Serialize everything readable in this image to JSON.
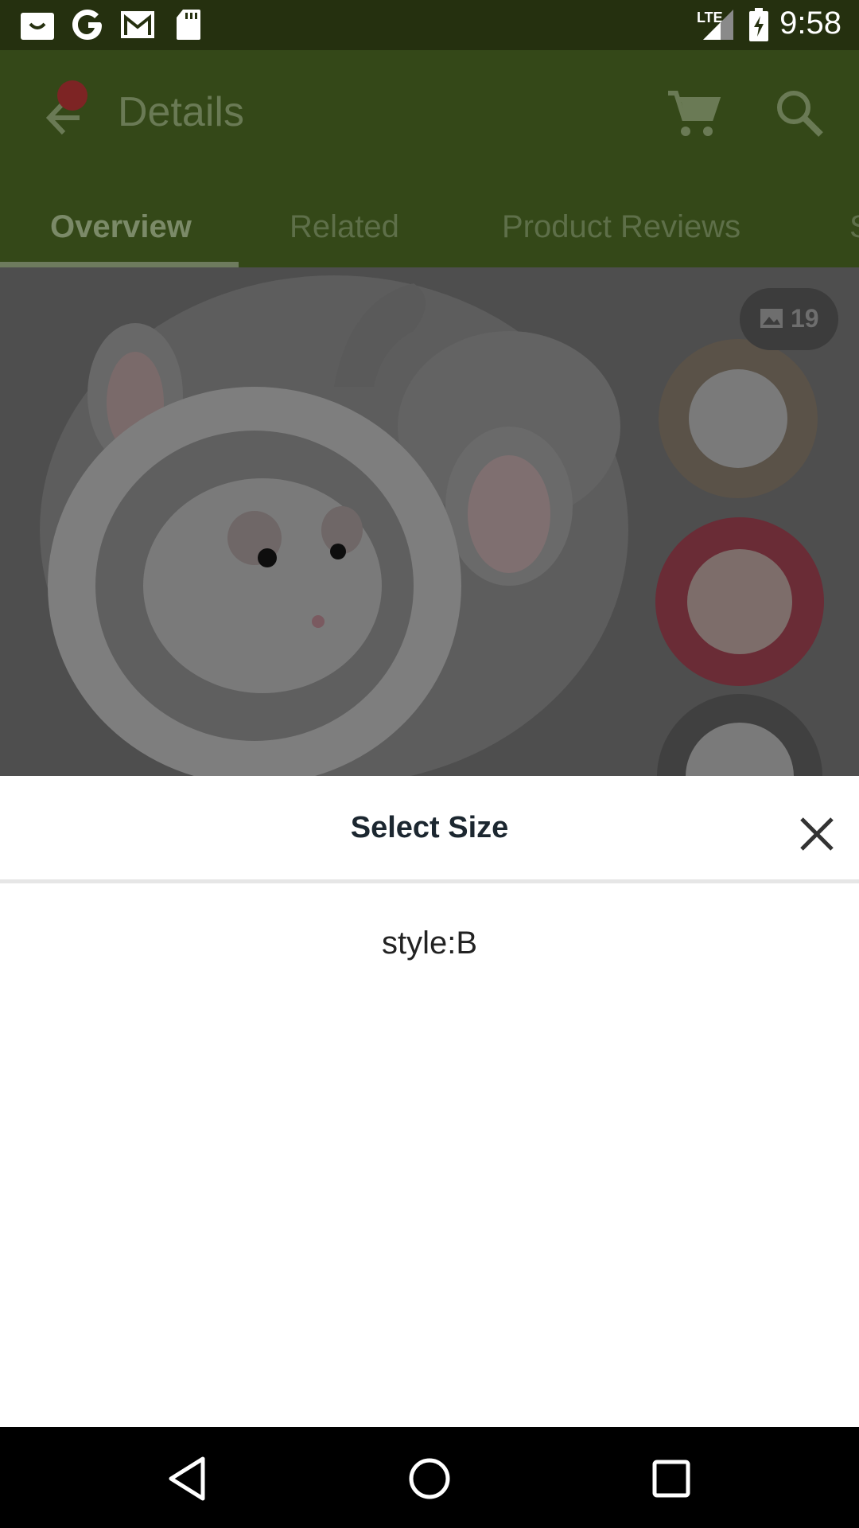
{
  "status_bar": {
    "time": "9:58",
    "network": "LTE",
    "icons": [
      "shopping-bag-icon",
      "google-icon",
      "gmail-icon",
      "sd-card-icon",
      "signal-icon",
      "battery-charging-icon"
    ]
  },
  "app_bar": {
    "title": "Details",
    "back_icon": "arrow-back-icon",
    "cart_icon": "cart-icon",
    "search_icon": "search-icon"
  },
  "tabs": [
    {
      "label": "Overview",
      "active": true
    },
    {
      "label": "Related",
      "active": false
    },
    {
      "label": "Product Reviews",
      "active": false
    },
    {
      "label": "S",
      "active": false
    }
  ],
  "gallery": {
    "photo_count": "19"
  },
  "sheet": {
    "title": "Select Size",
    "options": [
      "style:B"
    ]
  },
  "colors": {
    "status_bar": "#25300f",
    "app_bar_dimmed": "#344818",
    "sheet_background": "#ffffff"
  }
}
